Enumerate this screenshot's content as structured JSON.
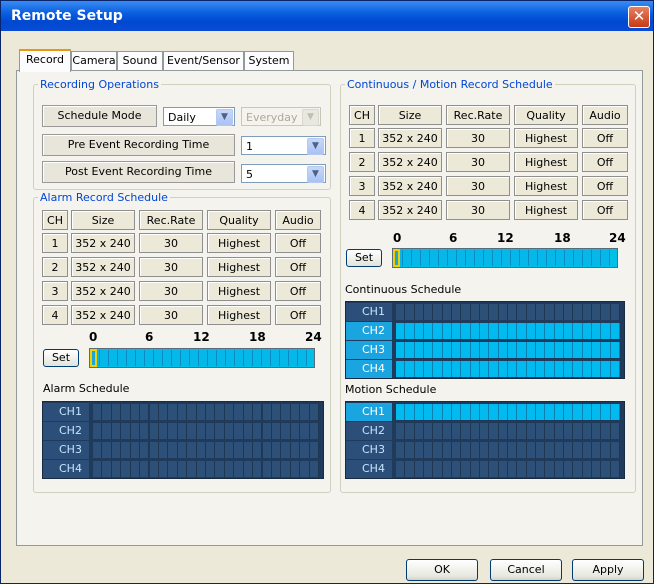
{
  "window": {
    "title": "Remote Setup",
    "close_glyph": "✕"
  },
  "tabs": [
    "Record",
    "Camera",
    "Sound",
    "Event/Sensor",
    "System"
  ],
  "recording_operations": {
    "legend": "Recording Operations",
    "schedule_mode_label": "Schedule Mode",
    "schedule_mode_value": "Daily",
    "day_value": "Everyday",
    "pre_event_label": "Pre Event Recording Time",
    "pre_event_value": "1",
    "post_event_label": "Post Event Recording Time",
    "post_event_value": "5"
  },
  "alarm_schedule_table": {
    "legend": "Alarm Record Schedule",
    "headers": [
      "CH",
      "Size",
      "Rec.Rate",
      "Quality",
      "Audio"
    ],
    "rows": [
      [
        "1",
        "352 x 240",
        "30",
        "Highest",
        "Off"
      ],
      [
        "2",
        "352 x 240",
        "30",
        "Highest",
        "Off"
      ],
      [
        "3",
        "352 x 240",
        "30",
        "Highest",
        "Off"
      ],
      [
        "4",
        "352 x 240",
        "30",
        "Highest",
        "Off"
      ]
    ],
    "hour_marks": [
      "0",
      "6",
      "12",
      "18",
      "24"
    ],
    "set_label": "Set",
    "schedule_label": "Alarm Schedule",
    "channels": [
      "CH1",
      "CH2",
      "CH3",
      "CH4"
    ],
    "active_channels": []
  },
  "continuous_table": {
    "legend": "Continuous / Motion Record Schedule",
    "headers": [
      "CH",
      "Size",
      "Rec.Rate",
      "Quality",
      "Audio"
    ],
    "rows": [
      [
        "1",
        "352 x 240",
        "30",
        "Highest",
        "Off"
      ],
      [
        "2",
        "352 x 240",
        "30",
        "Highest",
        "Off"
      ],
      [
        "3",
        "352 x 240",
        "30",
        "Highest",
        "Off"
      ],
      [
        "4",
        "352 x 240",
        "30",
        "Highest",
        "Off"
      ]
    ],
    "hour_marks": [
      "0",
      "6",
      "12",
      "18",
      "24"
    ],
    "set_label": "Set",
    "continuous_label": "Continuous Schedule",
    "continuous_channels": [
      "CH1",
      "CH2",
      "CH3",
      "CH4"
    ],
    "continuous_filled": [
      false,
      true,
      true,
      true
    ],
    "motion_label": "Motion  Schedule",
    "motion_channels": [
      "CH1",
      "CH2",
      "CH3",
      "CH4"
    ],
    "motion_filled": [
      true,
      false,
      false,
      false
    ]
  },
  "footer": {
    "ok": "OK",
    "cancel": "Cancel",
    "apply": "Apply"
  },
  "colors": {
    "title_bar": "#0a5fe0",
    "schedule_on": "#00baf0",
    "schedule_off": "#2c5078",
    "legend": "#0046d5"
  }
}
